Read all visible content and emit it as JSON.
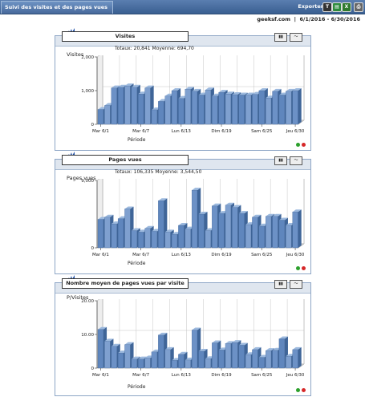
{
  "window": {
    "tab_title": "Suivi des visites et des pages vues",
    "export_label": "Exporter",
    "site": "geeksf.com",
    "date_range": "6/1/2016 - 6/30/2016"
  },
  "x_ticks": [
    "Mar 6/1",
    "Mar 6/7",
    "Lun 6/13",
    "Dim 6/19",
    "Sam 6/25",
    "Jeu 6/30"
  ],
  "chart_data": [
    {
      "type": "bar",
      "title": "Visites",
      "totals_line": "Totaux: 20,841   Moyenne: 694,70",
      "ylabel": "Visites",
      "xlabel": "Période",
      "ylim": [
        0,
        2000
      ],
      "yticks": [
        "0",
        "1,000",
        "2,000"
      ],
      "values": [
        440,
        560,
        1080,
        1100,
        1140,
        1100,
        900,
        1080,
        430,
        680,
        840,
        1000,
        770,
        1040,
        980,
        870,
        1020,
        840,
        950,
        900,
        880,
        870,
        870,
        890,
        1000,
        780,
        980,
        870,
        980,
        1000
      ]
    },
    {
      "type": "bar",
      "title": "Pages vues",
      "totals_line": "Totaux: 106,335   Moyenne: 3,544,50",
      "ylabel": "Pages vues",
      "xlabel": "Période",
      "ylim": [
        0,
        9000
      ],
      "yticks": [
        "0",
        "9,000"
      ],
      "values": [
        3800,
        4100,
        3200,
        3900,
        5200,
        2300,
        2100,
        2600,
        2200,
        6300,
        2100,
        1800,
        3000,
        2500,
        7700,
        4500,
        2300,
        5600,
        4600,
        5700,
        5400,
        4600,
        3100,
        4100,
        2900,
        4200,
        4200,
        3700,
        3000,
        4800
      ]
    },
    {
      "type": "bar",
      "title": "Nombre moyen de pages vues par visite",
      "totals_line": "",
      "ylabel": "P/Visites",
      "xlabel": "Période",
      "ylim": [
        0,
        20
      ],
      "yticks": [
        "0",
        "10.00",
        "20.00"
      ],
      "values": [
        11.5,
        8.0,
        6.5,
        4.5,
        7.0,
        2.7,
        2.7,
        3.0,
        4.8,
        9.8,
        5.5,
        2.3,
        4.1,
        2.4,
        11.3,
        5.0,
        2.8,
        7.5,
        5.4,
        7.3,
        7.6,
        6.8,
        4.0,
        5.5,
        3.2,
        5.2,
        5.3,
        8.7,
        3.5,
        5.5
      ]
    }
  ],
  "panels": [
    {
      "btn1": "▮▮",
      "btn2": "〜"
    },
    {
      "btn1": "▮▮",
      "btn2": "〜"
    },
    {
      "btn1": "▮▮",
      "btn2": "〜"
    }
  ],
  "colors": {
    "bar_front": "#5f86bd",
    "bar_light": "#9cb9de",
    "grid": "#b7b7b7",
    "status_green": "#2ca02c",
    "status_red": "#d62728"
  }
}
